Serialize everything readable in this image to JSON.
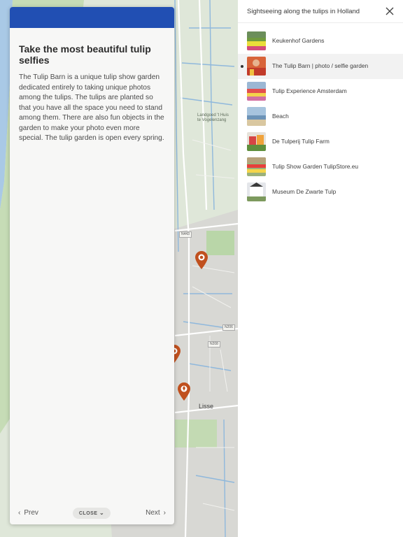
{
  "info_panel": {
    "title": "Take the most beautiful tulip selfies",
    "body": "The Tulip Barn is a unique tulip show garden dedicated entirely to taking unique photos among the tulips. The tulips are planted so that you have all the space you need to stand among them. There are also fun objects in the garden to make your photo even more special. The tulip garden is open every spring.",
    "prev_label": "Prev",
    "close_label": "CLOSE",
    "next_label": "Next",
    "header_color": "#214fb3"
  },
  "sidebar": {
    "title": "Sightseeing along the tulips in Holland",
    "items": [
      {
        "label": "Keukenhof Gardens",
        "active": false
      },
      {
        "label": "The Tulip Barn | photo / selfie garden",
        "active": true
      },
      {
        "label": "Tulip Experience Amsterdam",
        "active": false
      },
      {
        "label": "Beach",
        "active": false
      },
      {
        "label": "De Tulperij Tulip Farm",
        "active": false
      },
      {
        "label": "Tulip Show Garden TulipStore.eu",
        "active": false
      },
      {
        "label": "Museum De Zwarte Tulp",
        "active": false
      }
    ]
  },
  "map": {
    "labels": {
      "lisse": "Lisse",
      "landgoed": "Landgoed 't Huis te Vogelenzang",
      "road_n443": "N443",
      "road_n206": "N206",
      "road_n208": "N208"
    },
    "marker_color": "#c0501e"
  }
}
